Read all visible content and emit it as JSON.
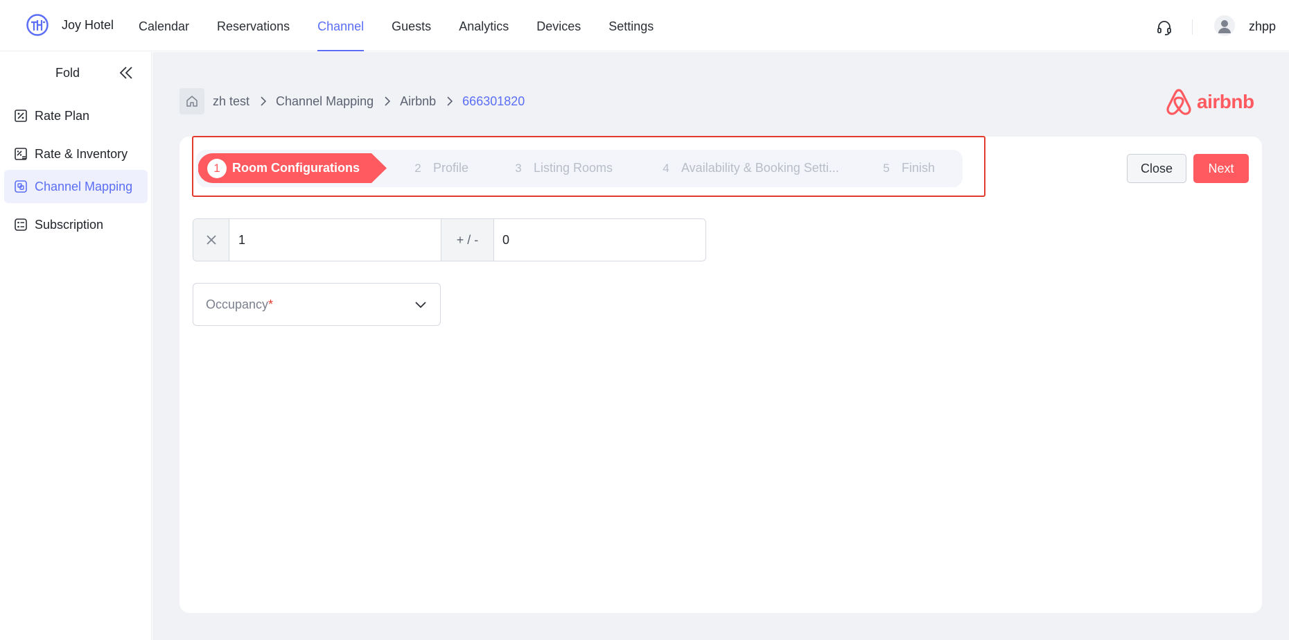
{
  "header": {
    "brand": "Joy Hotel",
    "nav": [
      "Calendar",
      "Reservations",
      "Channel",
      "Guests",
      "Analytics",
      "Devices",
      "Settings"
    ],
    "active_nav": "Channel",
    "username": "zhpp"
  },
  "sidebar": {
    "fold_label": "Fold",
    "items": [
      {
        "label": "Rate Plan",
        "icon": "rate-plan-icon"
      },
      {
        "label": "Rate & Inventory",
        "icon": "rate-inventory-icon"
      },
      {
        "label": "Channel Mapping",
        "icon": "channel-mapping-icon"
      },
      {
        "label": "Subscription",
        "icon": "subscription-icon"
      }
    ],
    "active": "Channel Mapping"
  },
  "breadcrumb": {
    "items": [
      "zh test",
      "Channel Mapping",
      "Airbnb"
    ],
    "current": "666301820"
  },
  "channel_logo": {
    "word": "airbnb",
    "color": "#ff5a5f"
  },
  "stepper": {
    "steps": [
      {
        "num": "1",
        "label": "Room Configurations"
      },
      {
        "num": "2",
        "label": "Profile"
      },
      {
        "num": "3",
        "label": "Listing Rooms"
      },
      {
        "num": "4",
        "label": "Availability & Booking Setti..."
      },
      {
        "num": "5",
        "label": "Finish"
      }
    ],
    "active_index": 0
  },
  "actions": {
    "close_label": "Close",
    "next_label": "Next"
  },
  "form": {
    "multiplier_value": "1",
    "plus_minus_label": "+ / -",
    "adjust_value": "0",
    "occupancy_placeholder": "Occupancy",
    "required_mark": "*"
  },
  "colors": {
    "accent": "#5b6ef5",
    "brand_red": "#ff5a5f",
    "highlight_border": "#e23b2e"
  }
}
